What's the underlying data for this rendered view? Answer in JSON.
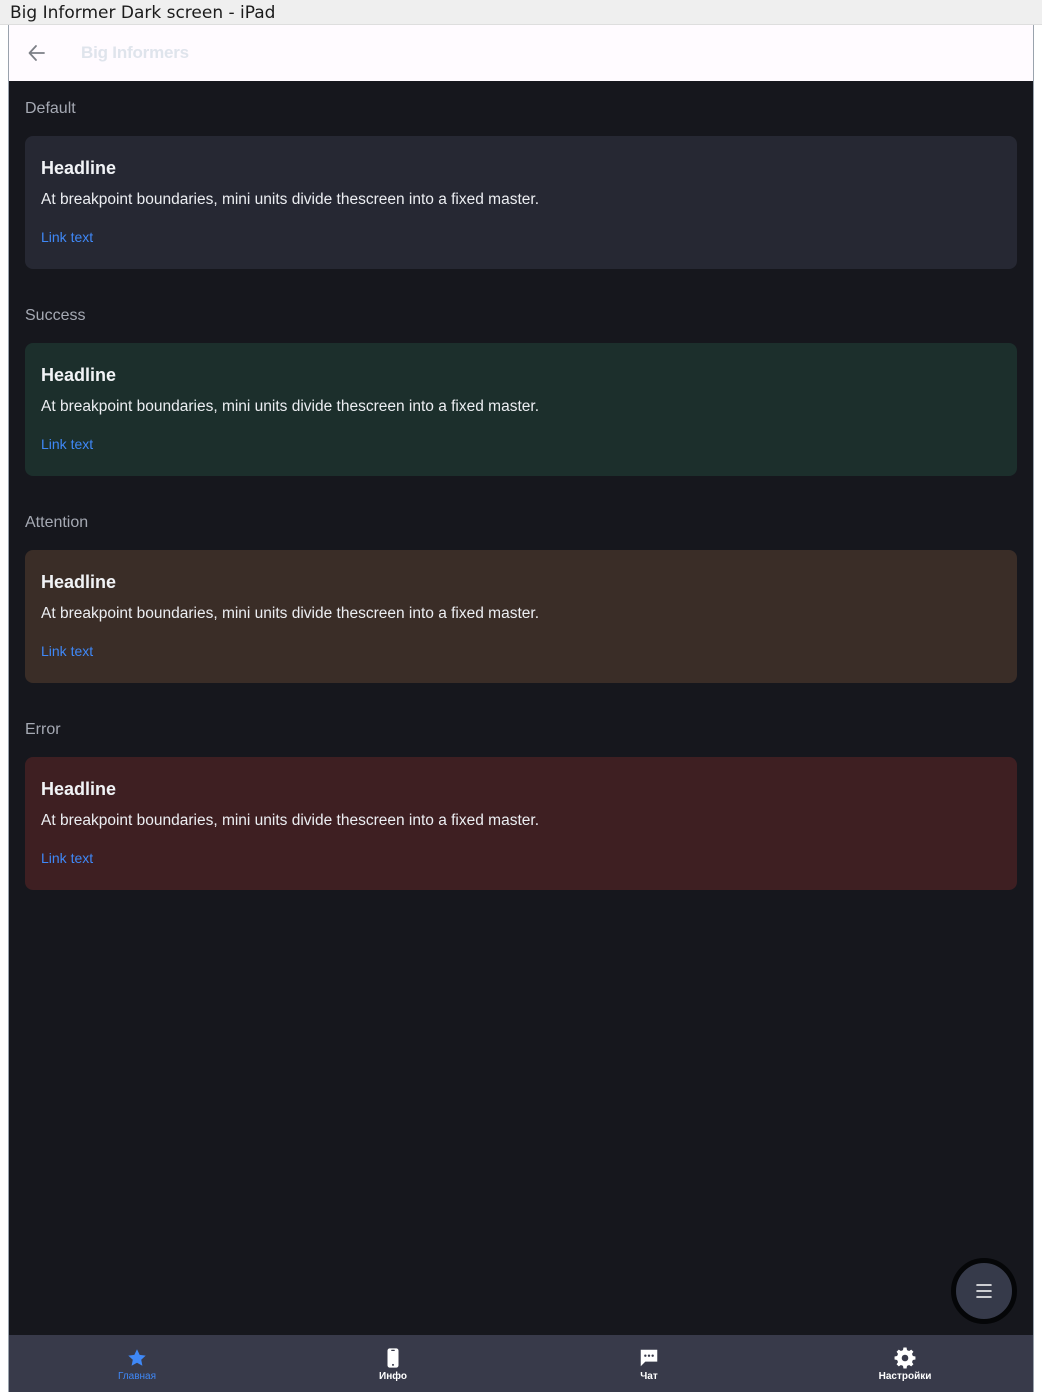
{
  "window": {
    "title": "Big Informer Dark screen - iPad"
  },
  "appbar": {
    "title": "Big Informers",
    "back_icon": "arrow-left-icon"
  },
  "sections": [
    {
      "label": "Default",
      "variant": "default",
      "bg": "#262833",
      "headline": "Headline",
      "text": "At breakpoint boundaries, mini units divide thescreen into a fixed master.",
      "link": "Link text"
    },
    {
      "label": "Success",
      "variant": "success",
      "bg": "#1c2f2c",
      "headline": "Headline",
      "text": "At breakpoint boundaries, mini units divide thescreen into a fixed master.",
      "link": "Link text"
    },
    {
      "label": "Attention",
      "variant": "attention",
      "bg": "#3a2d27",
      "headline": "Headline",
      "text": "At breakpoint boundaries, mini units divide thescreen into a fixed master.",
      "link": "Link text"
    },
    {
      "label": "Error",
      "variant": "error",
      "bg": "#3e1f22",
      "headline": "Headline",
      "text": "At breakpoint boundaries, mini units divide thescreen into a fixed master.",
      "link": "Link text"
    }
  ],
  "fab": {
    "icon": "menu-icon"
  },
  "bottom_nav": {
    "items": [
      {
        "label": "Главная",
        "icon": "star-icon",
        "active": true
      },
      {
        "label": "Инфо",
        "icon": "phone-icon",
        "active": false
      },
      {
        "label": "Чат",
        "icon": "chat-icon",
        "active": false
      },
      {
        "label": "Настройки",
        "icon": "gear-icon",
        "active": false
      }
    ]
  },
  "colors": {
    "background": "#16171d",
    "accent": "#3f88f7",
    "appbar": "#fffbff",
    "bottom_nav": "#383a4a"
  }
}
